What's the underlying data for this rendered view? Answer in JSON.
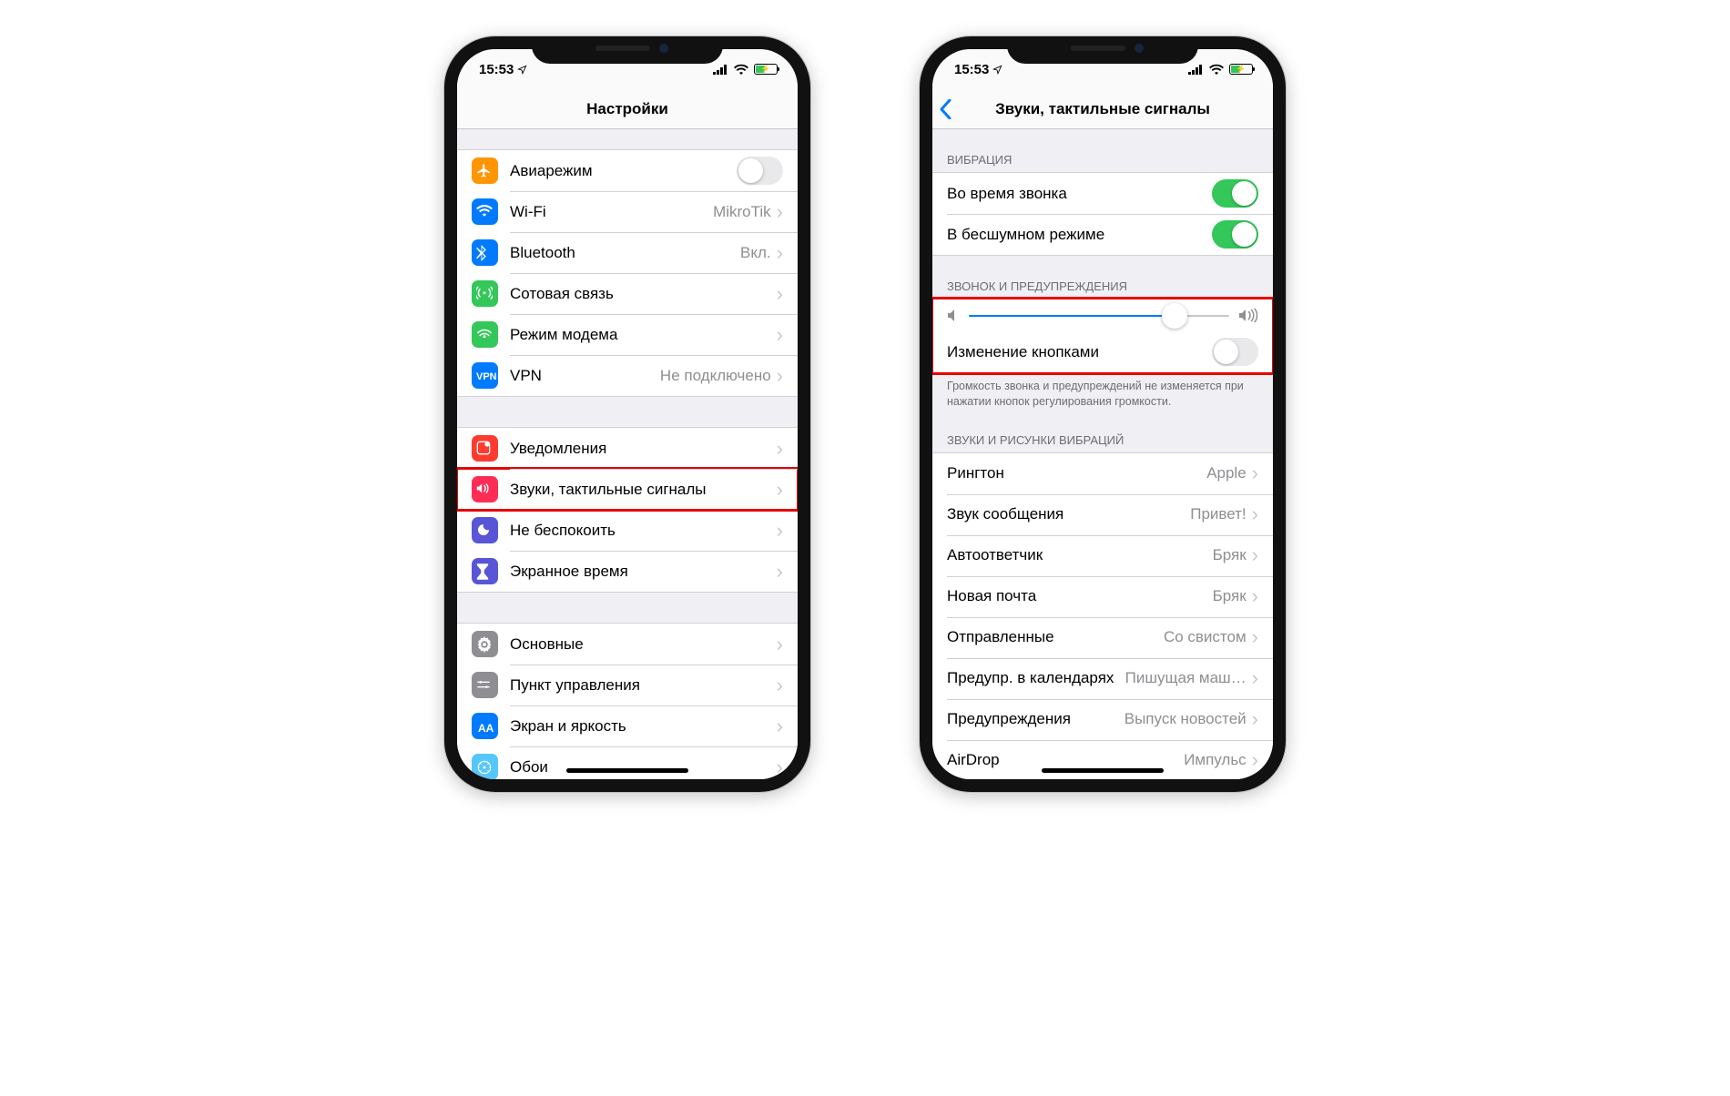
{
  "statusbar": {
    "time": "15:53"
  },
  "phone1": {
    "title": "Настройки",
    "group1": [
      {
        "icon": "airplane",
        "bg": "#ff9500",
        "label": "Авиарежим",
        "toggle": "off"
      },
      {
        "icon": "wifi",
        "bg": "#007aff",
        "label": "Wi-Fi",
        "value": "MikroTik"
      },
      {
        "icon": "bluetooth",
        "bg": "#007aff",
        "label": "Bluetooth",
        "value": "Вкл."
      },
      {
        "icon": "antenna",
        "bg": "#34c759",
        "label": "Сотовая связь"
      },
      {
        "icon": "hotspot",
        "bg": "#34c759",
        "label": "Режим модема"
      },
      {
        "icon": "vpn",
        "bg": "#007aff",
        "label": "VPN",
        "value": "Не подключено"
      }
    ],
    "group2": [
      {
        "icon": "notify",
        "bg": "#ff3b30",
        "label": "Уведомления"
      },
      {
        "icon": "sound",
        "bg": "#ff2d55",
        "label": "Звуки, тактильные сигналы",
        "highlight": true
      },
      {
        "icon": "dnd",
        "bg": "#5856d6",
        "label": "Не беспокоить"
      },
      {
        "icon": "screentime",
        "bg": "#5856d6",
        "label": "Экранное время"
      }
    ],
    "group3": [
      {
        "icon": "general",
        "bg": "#8e8e93",
        "label": "Основные"
      },
      {
        "icon": "control",
        "bg": "#8e8e93",
        "label": "Пункт управления"
      },
      {
        "icon": "display",
        "bg": "#007aff",
        "label": "Экран и яркость"
      },
      {
        "icon": "wallpaper",
        "bg": "#54c7fc",
        "label": "Обои"
      }
    ]
  },
  "phone2": {
    "title": "Звуки, тактильные сигналы",
    "headers": {
      "vibration": "ВИБРАЦИЯ",
      "ringer": "ЗВОНОК И ПРЕДУПРЕЖДЕНИЯ",
      "footer": "Громкость звонка и предупреждений не изменяется при нажатии кнопок регулирования громкости.",
      "patterns": "ЗВУКИ И РИСУНКИ ВИБРАЦИЙ"
    },
    "vibration": [
      {
        "label": "Во время звонка",
        "toggle": "on"
      },
      {
        "label": "В бесшумном режиме",
        "toggle": "on"
      }
    ],
    "ringer": {
      "slider_percent": 79,
      "change_with_buttons": {
        "label": "Изменение кнопками",
        "toggle": "off"
      }
    },
    "sounds": [
      {
        "label": "Рингтон",
        "value": "Apple"
      },
      {
        "label": "Звук сообщения",
        "value": "Привет!"
      },
      {
        "label": "Автоответчик",
        "value": "Бряк"
      },
      {
        "label": "Новая почта",
        "value": "Бряк"
      },
      {
        "label": "Отправленные",
        "value": "Со свистом"
      },
      {
        "label": "Предупр. в календарях",
        "value": "Пишущая маш…"
      },
      {
        "label": "Предупреждения",
        "value": "Выпуск новостей"
      },
      {
        "label": "AirDrop",
        "value": "Импульс"
      }
    ]
  }
}
